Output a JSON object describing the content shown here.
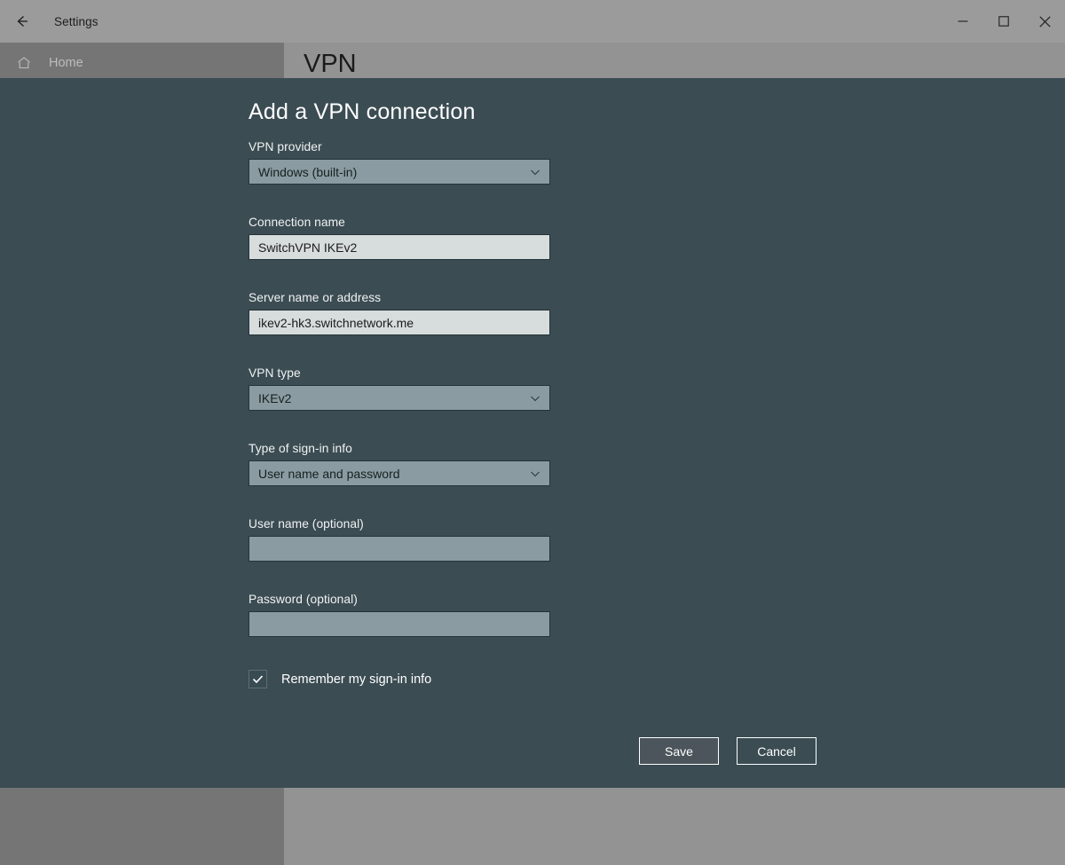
{
  "window": {
    "title": "Settings",
    "back_icon": "back-arrow-icon",
    "controls": {
      "minimize": "minimize-icon",
      "maximize": "maximize-icon",
      "close": "close-icon"
    }
  },
  "sidebar": {
    "home_label": "Home",
    "home_icon": "home-icon"
  },
  "content": {
    "page_title": "VPN"
  },
  "dialog": {
    "heading": "Add a VPN connection",
    "fields": [
      {
        "label": "VPN provider",
        "type": "combo",
        "value": "Windows (built-in)"
      },
      {
        "label": "Connection name",
        "type": "text",
        "value": "SwitchVPN IKEv2"
      },
      {
        "label": "Server name or address",
        "type": "text",
        "value": "ikev2-hk3.switchnetwork.me"
      },
      {
        "label": "VPN type",
        "type": "combo",
        "value": "IKEv2"
      },
      {
        "label": "Type of sign-in info",
        "type": "combo",
        "value": "User name and password"
      },
      {
        "label": "User name (optional)",
        "type": "text",
        "value": ""
      },
      {
        "label": "Password (optional)",
        "type": "text",
        "value": ""
      }
    ],
    "remember": {
      "label": "Remember my sign-in info",
      "checked": true,
      "icon": "checkmark-icon"
    },
    "buttons": {
      "save": "Save",
      "cancel": "Cancel"
    }
  }
}
